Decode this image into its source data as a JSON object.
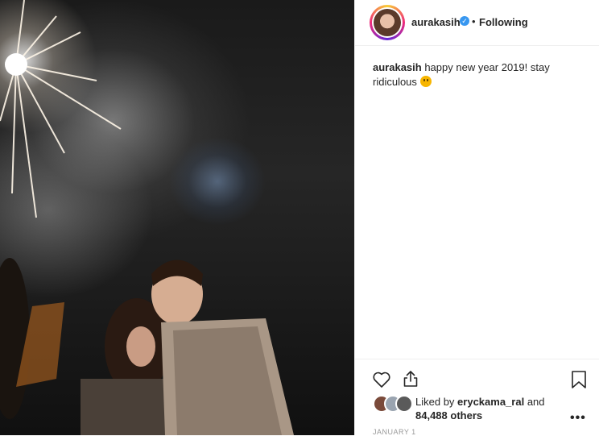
{
  "post": {
    "username": "aurakasih",
    "separator": "•",
    "follow_status": "Following",
    "caption_username": "aurakasih",
    "caption_text": "happy new year 2019! stay ridiculous",
    "likes_prefix": "Liked by",
    "liked_user": "eryckama_ral",
    "likes_conjunction": "and",
    "likes_others": "84,488 others",
    "date": "JANUARY 1",
    "more": "•••"
  },
  "icons": {
    "verified": "verified-badge-icon",
    "like": "heart-icon",
    "share": "share-icon",
    "bookmark": "bookmark-icon",
    "emoji": "tongue-out-emoji-icon"
  },
  "colors": {
    "verified": "#3897f0",
    "text": "#262626",
    "muted": "#999999",
    "border": "#efefef"
  }
}
